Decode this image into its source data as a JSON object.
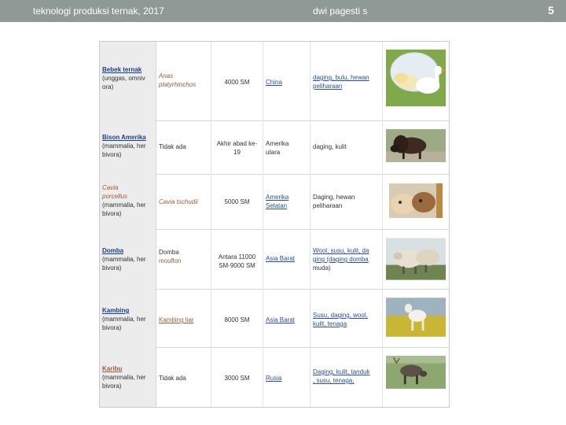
{
  "header": {
    "left": "teknologi produksi ternak, 2017",
    "center": "dwi pagesti s",
    "page": "5"
  },
  "rows": [
    {
      "name": [
        "Bebek ternak",
        "(unggas, omniv",
        "ora)"
      ],
      "species": [
        "Anas",
        "platyrhinchos"
      ],
      "time": [
        "4000 SM"
      ],
      "origin": [
        "China"
      ],
      "use": [
        "daging, bulu, hewan",
        "peliharaan"
      ],
      "image": "white ducks"
    },
    {
      "name": [
        "Bison Amerika",
        "(mammalia, her",
        "bivora)"
      ],
      "species": [
        "Tidak ada"
      ],
      "time": [
        "Akhir abad ke-",
        "19"
      ],
      "origin": [
        "Amerika",
        "utara"
      ],
      "use": [
        "daging, kulit"
      ],
      "image": "american bison"
    },
    {
      "name": [
        "Cavia",
        "porcellus",
        "(mammalia, her",
        "bivora)"
      ],
      "species": [
        "Cavia tschudii"
      ],
      "time": [
        "5000 SM"
      ],
      "origin": [
        "Amerika",
        "Selatan"
      ],
      "use": [
        "Daging, hewan",
        "peliharaan"
      ],
      "image": "guinea pigs"
    },
    {
      "name": [
        "Domba",
        "(mammalia, her",
        "bivora)"
      ],
      "species": [
        "Domba",
        "",
        "mouflon"
      ],
      "time": [
        "Antara 11000",
        "SM-9000 SM"
      ],
      "origin": [
        "Asia Barat"
      ],
      "use": [
        "Wool, susu, kulit, da",
        "ging (daging domba",
        "muda)"
      ],
      "image": "sheep"
    },
    {
      "name": [
        "Kambing",
        "(mammalia, her",
        "bivora)"
      ],
      "species": [
        "Kambing liar"
      ],
      "time": [
        "8000 SM"
      ],
      "origin": [
        "Asia Barat"
      ],
      "use": [
        "Susu, daging, wool,",
        "kulit, tenaga"
      ],
      "image": "goat"
    },
    {
      "name": [
        "Karibu",
        "(mammalia, her",
        "bivora)"
      ],
      "species": [
        "Tidak ada"
      ],
      "time": [
        "3000 SM"
      ],
      "origin": [
        "Rusia"
      ],
      "use": [
        "Daging, kulit, tanduk",
        ", susu, tenaga,"
      ],
      "image": "reindeer"
    }
  ]
}
